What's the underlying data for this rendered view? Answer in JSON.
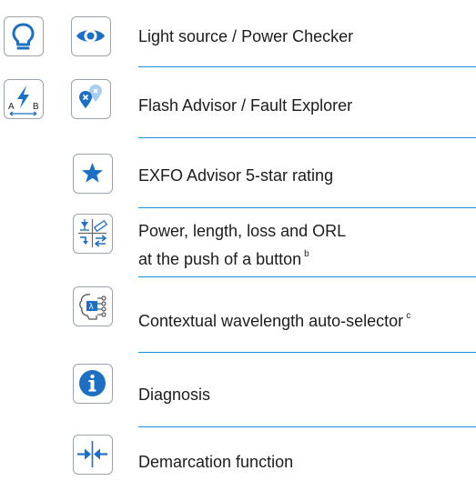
{
  "features": [
    {
      "label": "Light source / Power Checker",
      "icons": [
        "lightbulb-icon",
        "eye-icon"
      ]
    },
    {
      "label": "Flash Advisor / Fault Explorer",
      "icons": [
        "flash-advisor-icon",
        "fault-explorer-icon"
      ],
      "icon_text": [
        "A",
        "B"
      ]
    },
    {
      "label": "EXFO Advisor 5-star rating",
      "icons": [
        "star-icon"
      ]
    },
    {
      "label_line1": "Power, length, loss and ORL",
      "label_line2": "at the push of a button",
      "footnote": "b",
      "icons": [
        "power-length-loss-orl-icon"
      ]
    },
    {
      "label": "Contextual wavelength auto-selector",
      "footnote": "c",
      "icons": [
        "wavelength-selector-icon"
      ],
      "icon_text": "λ"
    },
    {
      "label": "Diagnosis",
      "icons": [
        "info-icon"
      ]
    },
    {
      "label": "Demarcation function",
      "icons": [
        "demarcation-icon"
      ]
    }
  ],
  "colors": {
    "accent": "#1d6fc4",
    "border": "#9aa3ad",
    "divider": "#1d8fd8",
    "text": "#1c1c1c"
  }
}
